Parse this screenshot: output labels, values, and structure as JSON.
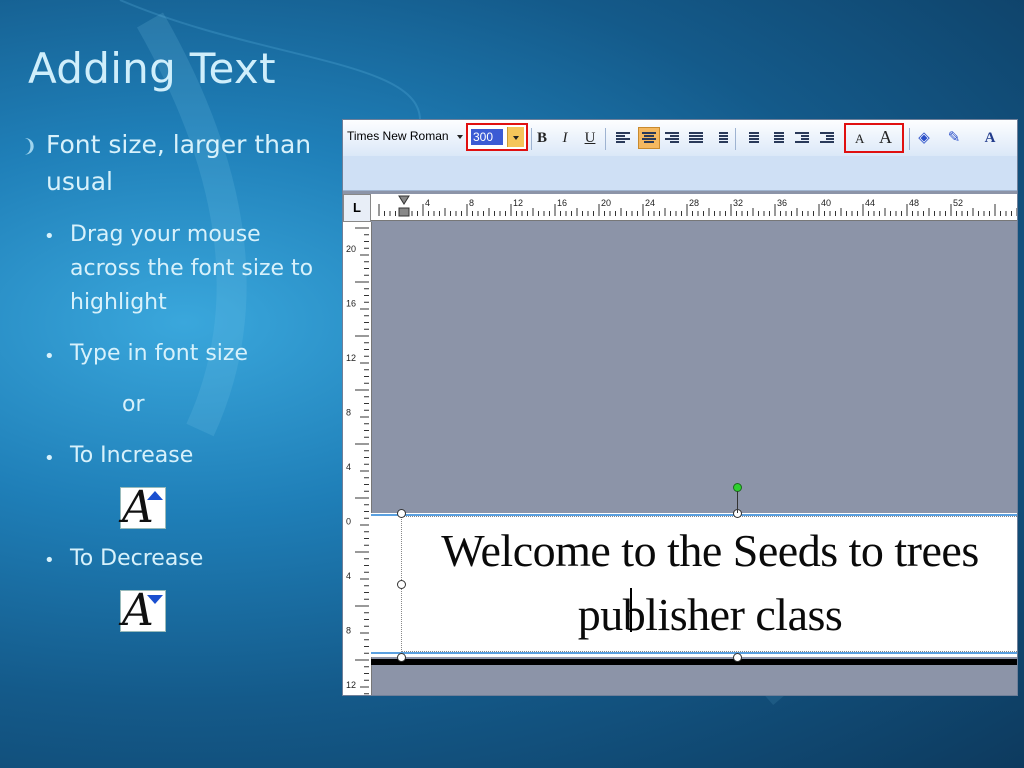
{
  "slide": {
    "title": "Adding Text",
    "bullets": {
      "main": "Font size, larger than usual",
      "drag": "Drag your mouse across the font size to highlight",
      "type": "Type in font size",
      "or": "or",
      "increase": "To Increase",
      "decrease": "To Decrease"
    }
  },
  "publisher": {
    "font_name": "Times New Roman",
    "font_size": "300",
    "bold": "B",
    "italic": "I",
    "underline": "U",
    "ruler_corner": "L",
    "hruler_labels": [
      "4",
      "8",
      "12",
      "16",
      "20",
      "24",
      "28",
      "32",
      "36",
      "40",
      "44",
      "48",
      "52"
    ],
    "vruler_labels": [
      "20",
      "16",
      "12",
      "8",
      "4",
      "0",
      "4",
      "8",
      "12"
    ],
    "text_line1": "Welcome to the Seeds to trees",
    "text_line2": "publisher class"
  },
  "colors": {
    "highlight_box": "#e01010",
    "selected_size": "#3b5bd4",
    "canvas": "#8c94a8"
  }
}
